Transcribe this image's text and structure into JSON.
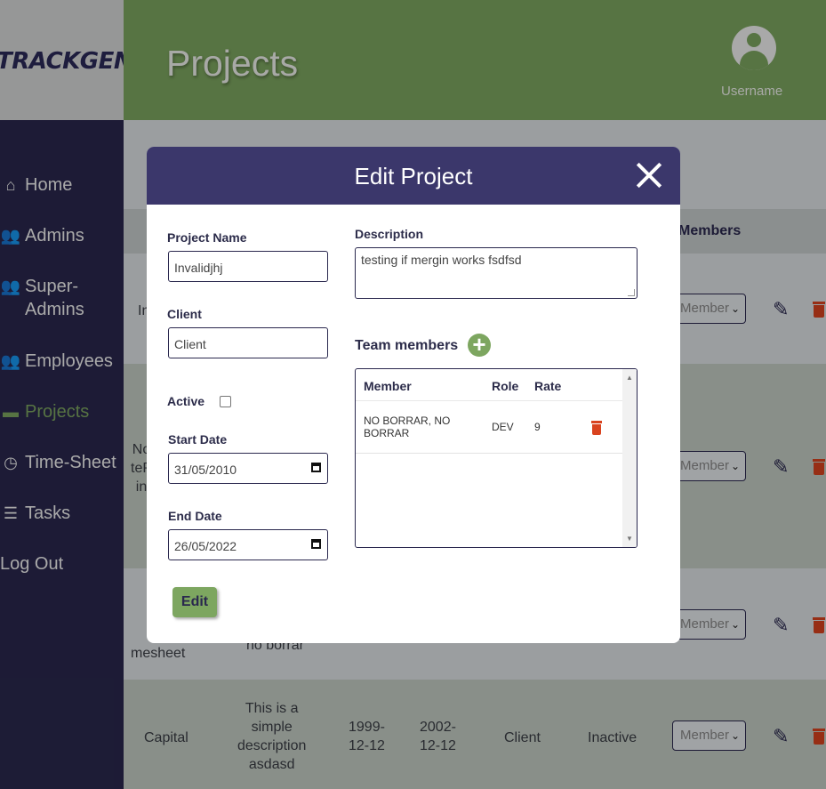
{
  "app": {
    "logo": "TRACKGENIX",
    "page_title": "Projects",
    "username": "Username"
  },
  "sidebar": {
    "items": [
      {
        "label": "Home",
        "icon": "home-icon"
      },
      {
        "label": "Admins",
        "icon": "users-icon"
      },
      {
        "label": "Super-\nAdmins",
        "icon": "users-icon"
      },
      {
        "label": "Employees",
        "icon": "users-icon"
      },
      {
        "label": "Projects",
        "icon": "folder-icon",
        "active": true
      },
      {
        "label": "Time-Sheet",
        "icon": "clock-icon"
      },
      {
        "label": "Tasks",
        "icon": "list-check-icon"
      },
      {
        "label": "Log Out",
        "icon": ""
      }
    ]
  },
  "table": {
    "members_header": "Members",
    "select_value": "Member",
    "rows": [
      {
        "name": "In"
      },
      {
        "name": "No\nteP\nin"
      },
      {
        "name": "Se\noB\nPr\nmesheet",
        "description": "no borrar"
      },
      {
        "name": "Capital",
        "description": "This is a\nsimple\ndescription\nasdasd",
        "start": "1999-\n12-12",
        "end": "2002-\n12-12",
        "client": "Client",
        "status": "Inactive"
      }
    ]
  },
  "modal": {
    "title": "Edit Project",
    "labels": {
      "project_name": "Project Name",
      "client": "Client",
      "active": "Active",
      "start_date": "Start Date",
      "end_date": "End Date",
      "description": "Description",
      "team_members": "Team members"
    },
    "values": {
      "project_name": "Invalidjhj",
      "client": "Client",
      "start_date": "31/05/2010",
      "end_date": "26/05/2022",
      "description": "testing if mergin works fsdfsd",
      "active": false
    },
    "team_table": {
      "headers": [
        "Member",
        "Role",
        "Rate"
      ],
      "rows": [
        {
          "member": "NO BORRAR, NO\nBORRAR",
          "role": "DEV",
          "rate": "9"
        }
      ]
    },
    "edit_button": "Edit",
    "add_icon": "plus-icon",
    "close_icon": "close-icon"
  },
  "colors": {
    "primary": "#2a284e",
    "accent": "#7da660",
    "modal_header": "#3b376b",
    "danger": "#d9431f"
  }
}
